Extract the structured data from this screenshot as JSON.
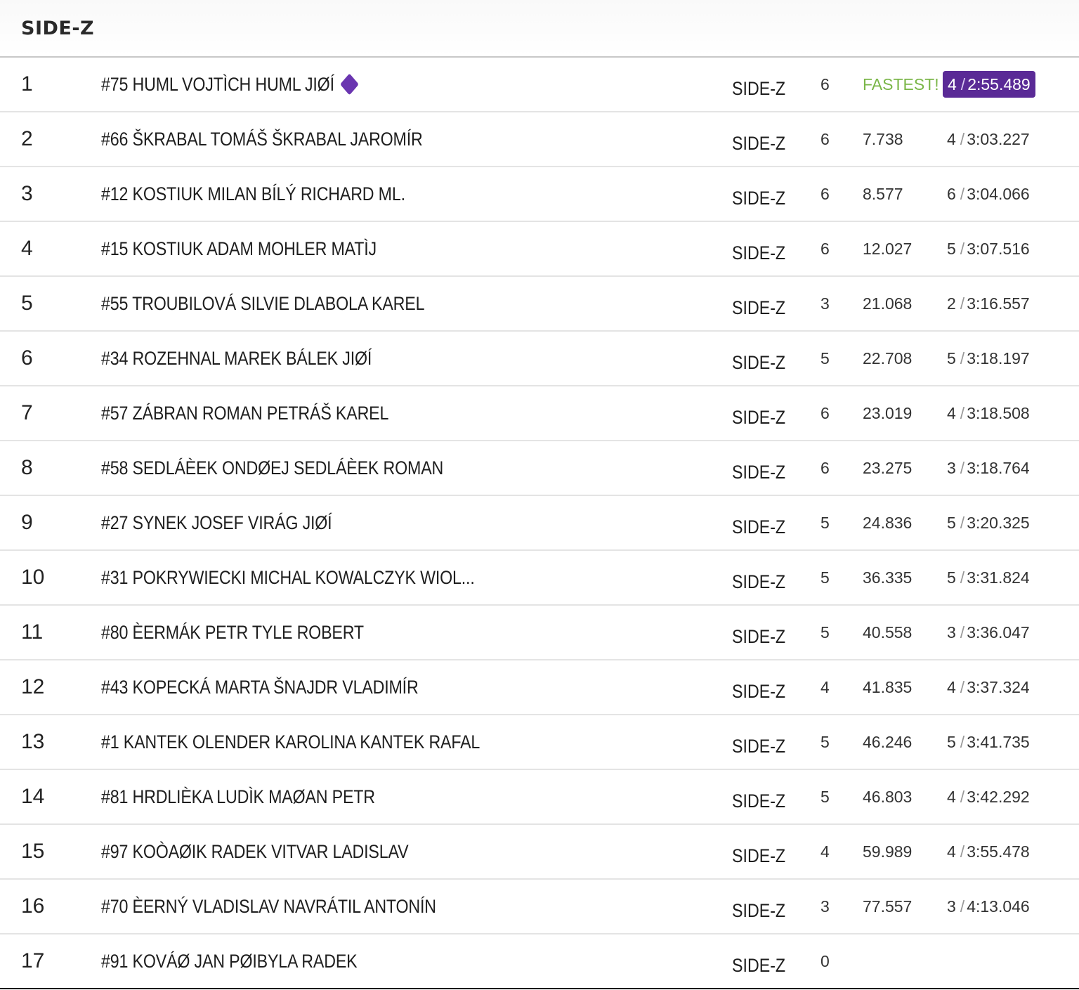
{
  "header": {
    "title": "SIDE-Z"
  },
  "separator": "/",
  "rows": [
    {
      "pos": "1",
      "name": "#75 HUML VOJTÌCH HUML JIØÍ",
      "cls": "SIDE-Z",
      "laps": "6",
      "gap": "FASTEST!",
      "best_lap": "4",
      "best_time": "2:55.489",
      "fastest": true
    },
    {
      "pos": "2",
      "name": "#66 ŠKRABAL TOMÁŠ ŠKRABAL JAROMÍR",
      "cls": "SIDE-Z",
      "laps": "6",
      "gap": "7.738",
      "best_lap": "4",
      "best_time": "3:03.227"
    },
    {
      "pos": "3",
      "name": "#12 KOSTIUK MILAN BÍLÝ RICHARD ML.",
      "cls": "SIDE-Z",
      "laps": "6",
      "gap": "8.577",
      "best_lap": "6",
      "best_time": "3:04.066"
    },
    {
      "pos": "4",
      "name": "#15 KOSTIUK ADAM MOHLER MATÌJ",
      "cls": "SIDE-Z",
      "laps": "6",
      "gap": "12.027",
      "best_lap": "5",
      "best_time": "3:07.516"
    },
    {
      "pos": "5",
      "name": "#55 TROUBILOVÁ SILVIE DLABOLA KAREL",
      "cls": "SIDE-Z",
      "laps": "3",
      "gap": "21.068",
      "best_lap": "2",
      "best_time": "3:16.557"
    },
    {
      "pos": "6",
      "name": "#34 ROZEHNAL MAREK BÁLEK JIØÍ",
      "cls": "SIDE-Z",
      "laps": "5",
      "gap": "22.708",
      "best_lap": "5",
      "best_time": "3:18.197"
    },
    {
      "pos": "7",
      "name": "#57 ZÁBRAN ROMAN PETRÁŠ KAREL",
      "cls": "SIDE-Z",
      "laps": "6",
      "gap": "23.019",
      "best_lap": "4",
      "best_time": "3:18.508"
    },
    {
      "pos": "8",
      "name": "#58 SEDLÁÈEK ONDØEJ SEDLÁÈEK ROMAN",
      "cls": "SIDE-Z",
      "laps": "6",
      "gap": "23.275",
      "best_lap": "3",
      "best_time": "3:18.764"
    },
    {
      "pos": "9",
      "name": "#27 SYNEK JOSEF VIRÁG JIØÍ",
      "cls": "SIDE-Z",
      "laps": "5",
      "gap": "24.836",
      "best_lap": "5",
      "best_time": "3:20.325"
    },
    {
      "pos": "10",
      "name": "#31 POKRYWIECKI MICHAL KOWALCZYK WIOL...",
      "cls": "SIDE-Z",
      "laps": "5",
      "gap": "36.335",
      "best_lap": "5",
      "best_time": "3:31.824"
    },
    {
      "pos": "11",
      "name": "#80 ÈERMÁK PETR TYLE ROBERT",
      "cls": "SIDE-Z",
      "laps": "5",
      "gap": "40.558",
      "best_lap": "3",
      "best_time": "3:36.047"
    },
    {
      "pos": "12",
      "name": "#43 KOPECKÁ MARTA ŠNAJDR VLADIMÍR",
      "cls": "SIDE-Z",
      "laps": "4",
      "gap": "41.835",
      "best_lap": "4",
      "best_time": "3:37.324"
    },
    {
      "pos": "13",
      "name": "#1 KANTEK OLENDER KAROLINA KANTEK RAFAL",
      "cls": "SIDE-Z",
      "laps": "5",
      "gap": "46.246",
      "best_lap": "5",
      "best_time": "3:41.735"
    },
    {
      "pos": "14",
      "name": "#81 HRDLIÈKA LUDÌK MAØAN PETR",
      "cls": "SIDE-Z",
      "laps": "5",
      "gap": "46.803",
      "best_lap": "4",
      "best_time": "3:42.292"
    },
    {
      "pos": "15",
      "name": "#97 KOÒAØIK RADEK VITVAR LADISLAV",
      "cls": "SIDE-Z",
      "laps": "4",
      "gap": "59.989",
      "best_lap": "4",
      "best_time": "3:55.478"
    },
    {
      "pos": "16",
      "name": "#70 ÈERNÝ VLADISLAV NAVRÁTIL ANTONÍN",
      "cls": "SIDE-Z",
      "laps": "3",
      "gap": "77.557",
      "best_lap": "3",
      "best_time": "4:13.046"
    },
    {
      "pos": "17",
      "name": "#91 KOVÁØ JAN PØIBYLA RADEK",
      "cls": "SIDE-Z",
      "laps": "0",
      "gap": "",
      "best_lap": "",
      "best_time": ""
    }
  ]
}
